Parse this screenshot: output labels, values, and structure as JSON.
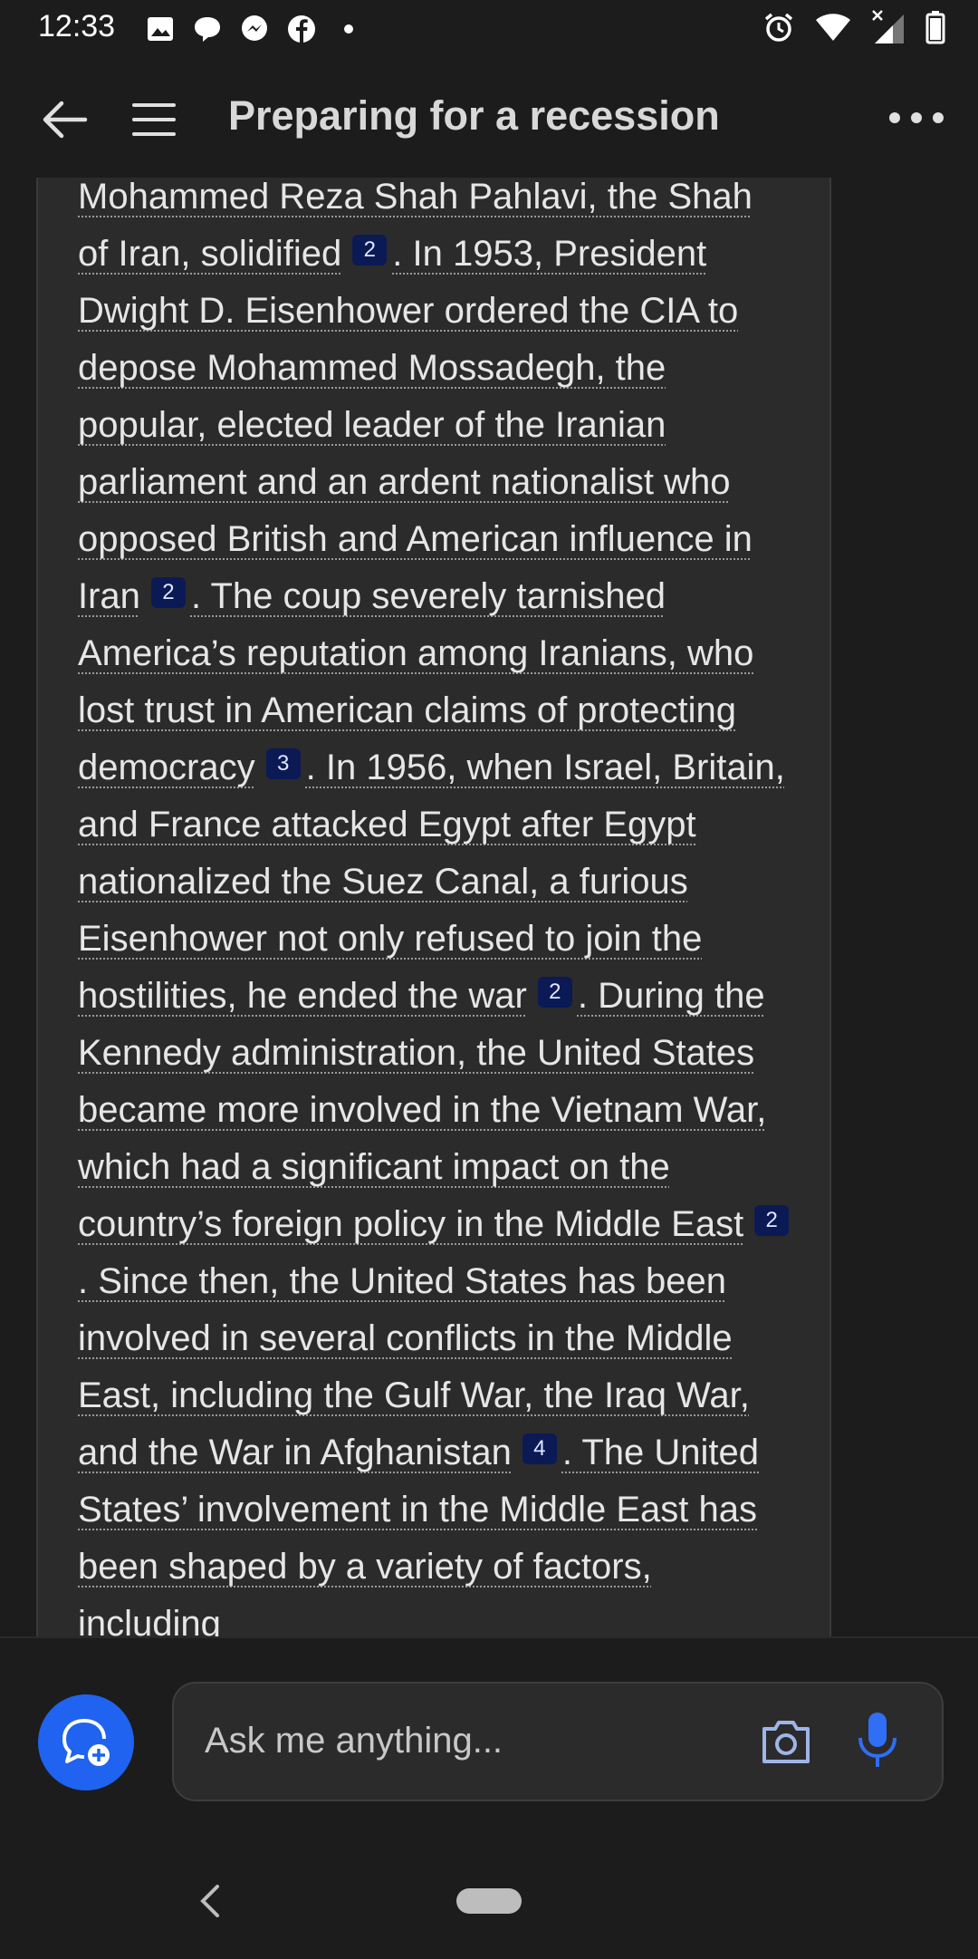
{
  "status_bar": {
    "time": "12:33",
    "left_icons": [
      "gallery-icon",
      "chat-bubble-icon",
      "messenger-icon",
      "facebook-icon",
      "dot-icon"
    ],
    "right_icons": [
      "alarm-icon",
      "wifi-icon",
      "signal-icon",
      "battery-icon"
    ]
  },
  "header": {
    "title": "Preparing for a recession",
    "back_icon": "arrow-left-icon",
    "menu_icon": "hamburger-icon",
    "more_icon": "more-horizontal-icon"
  },
  "message": {
    "top_cut_line": "Mohammed Reza Shah Pahlavi, the Shah",
    "segments": [
      {
        "text": "of Iran, solidified",
        "cite": "2"
      },
      {
        "text": ". In 1953, President Dwight D. Eisenhower ordered the CIA to depose Mohammed Mossadegh, the popular, elected leader of the Iranian parliament and an ardent nationalist who opposed British and American influence in Iran",
        "cite": "2"
      },
      {
        "text": ". The coup severely tarnished America’s reputation among Iranians, who lost trust in American claims of protecting democracy",
        "cite": "3"
      },
      {
        "text": ". In 1956, when Israel, Britain, and France attacked Egypt after Egypt nationalized the Suez Canal, a furious Eisenhower not only refused to join the hostilities, he ended the war",
        "cite": "2"
      },
      {
        "text": ". During the Kennedy administration, the United States became more involved in the Vietnam War, which had a significant impact on the country’s foreign policy in the Middle East",
        "cite": "2"
      },
      {
        "text": ". Since then, the United States has been involved in several conflicts in the Middle East, including the Gulf War, the Iraq War, and the War in Afghanistan",
        "cite": "4"
      },
      {
        "text": ". The United States’ involvement in the Middle East has been shaped by a variety of factors, including",
        "cite": null
      }
    ]
  },
  "composer": {
    "placeholder": "Ask me anything...",
    "new_topic_icon": "new-topic-chat-icon",
    "camera_icon": "camera-icon",
    "mic_icon": "microphone-icon"
  },
  "colors": {
    "background": "#1c1c1c",
    "card": "#2b2b2b",
    "accent": "#1f63f0",
    "citation_badge": "#0b1a55"
  }
}
